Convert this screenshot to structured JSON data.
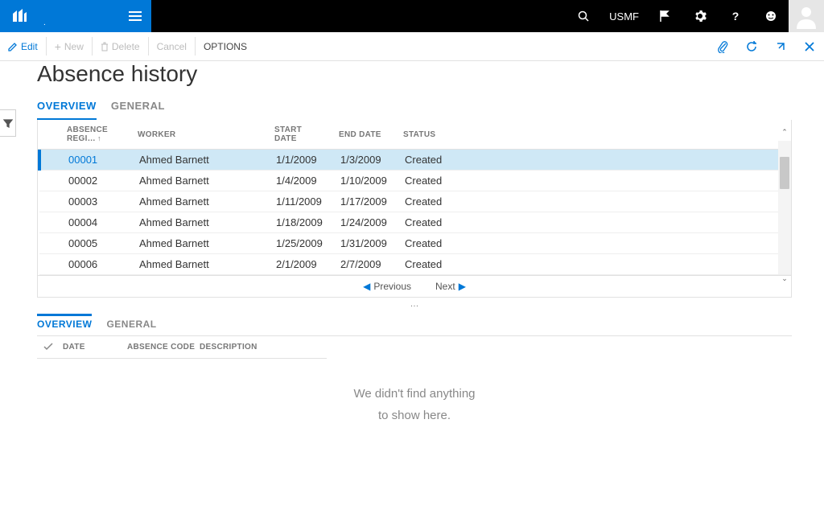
{
  "topbar": {
    "company": "USMF"
  },
  "actionbar": {
    "edit": "Edit",
    "new": "New",
    "delete": "Delete",
    "cancel": "Cancel",
    "options": "OPTIONS"
  },
  "page": {
    "title": "Absence history"
  },
  "tabs": {
    "overview": "OVERVIEW",
    "general": "GENERAL"
  },
  "grid": {
    "headers": {
      "absence_reg": "ABSENCE REGI…",
      "worker": "WORKER",
      "start_date": "START DATE",
      "end_date": "END DATE",
      "status": "STATUS"
    },
    "rows": [
      {
        "id": "00001",
        "worker": "Ahmed Barnett",
        "start": "1/1/2009",
        "end": "1/3/2009",
        "status": "Created",
        "selected": true
      },
      {
        "id": "00002",
        "worker": "Ahmed Barnett",
        "start": "1/4/2009",
        "end": "1/10/2009",
        "status": "Created",
        "selected": false
      },
      {
        "id": "00003",
        "worker": "Ahmed Barnett",
        "start": "1/11/2009",
        "end": "1/17/2009",
        "status": "Created",
        "selected": false
      },
      {
        "id": "00004",
        "worker": "Ahmed Barnett",
        "start": "1/18/2009",
        "end": "1/24/2009",
        "status": "Created",
        "selected": false
      },
      {
        "id": "00005",
        "worker": "Ahmed Barnett",
        "start": "1/25/2009",
        "end": "1/31/2009",
        "status": "Created",
        "selected": false
      },
      {
        "id": "00006",
        "worker": "Ahmed Barnett",
        "start": "2/1/2009",
        "end": "2/7/2009",
        "status": "Created",
        "selected": false
      }
    ]
  },
  "pager": {
    "previous": "Previous",
    "next": "Next"
  },
  "detail": {
    "tabs": {
      "overview": "OVERVIEW",
      "general": "GENERAL"
    },
    "headers": {
      "date": "DATE",
      "absence_code": "ABSENCE CODE",
      "description": "DESCRIPTION"
    },
    "empty_line1": "We didn't find anything",
    "empty_line2": "to show here."
  }
}
